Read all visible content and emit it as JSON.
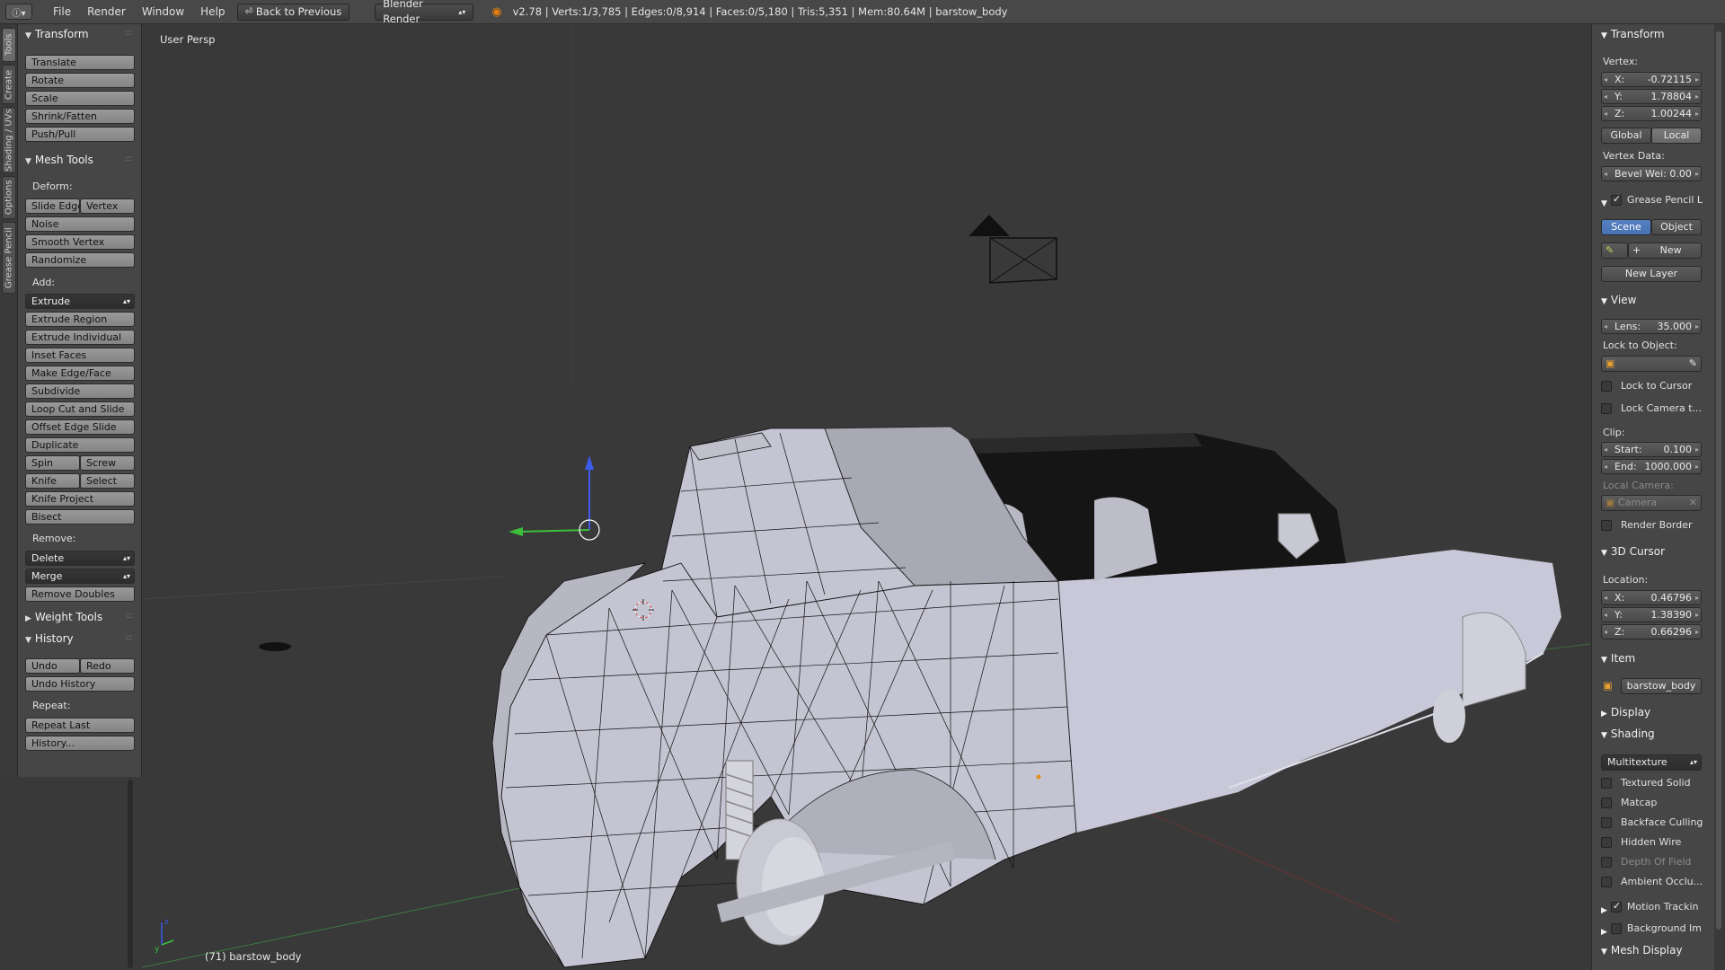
{
  "topbar": {
    "menus": [
      "File",
      "Render",
      "Window",
      "Help"
    ],
    "back_button": "Back to Previous",
    "engine": "Blender Render",
    "stats": "v2.78 | Verts:1/3,785 | Edges:0/8,914 | Faces:0/5,180 | Tris:5,351 | Mem:80.64M | barstow_body"
  },
  "tool_tabs": [
    "Tools",
    "Create",
    "Shading / UVs",
    "Options",
    "Grease Pencil"
  ],
  "left": {
    "transform": {
      "title": "Transform",
      "buttons": [
        "Translate",
        "Rotate",
        "Scale",
        "Shrink/Fatten",
        "Push/Pull"
      ]
    },
    "mesh_tools": {
      "title": "Mesh Tools",
      "deform_label": "Deform:",
      "slide_edge": "Slide Edge",
      "vertex": "Vertex",
      "noise": "Noise",
      "smooth_vertex": "Smooth Vertex",
      "randomize": "Randomize",
      "add_label": "Add:",
      "extrude": "Extrude",
      "extrude_region": "Extrude Region",
      "extrude_individual": "Extrude Individual",
      "inset_faces": "Inset Faces",
      "make_edge_face": "Make Edge/Face",
      "subdivide": "Subdivide",
      "loop_cut": "Loop Cut and Slide",
      "offset_edge": "Offset Edge Slide",
      "duplicate": "Duplicate",
      "spin": "Spin",
      "screw": "Screw",
      "knife": "Knife",
      "select": "Select",
      "knife_project": "Knife Project",
      "bisect": "Bisect",
      "remove_label": "Remove:",
      "delete": "Delete",
      "merge": "Merge",
      "remove_doubles": "Remove Doubles"
    },
    "weight_tools": {
      "title": "Weight Tools"
    },
    "history": {
      "title": "History",
      "undo": "Undo",
      "redo": "Redo",
      "undo_history": "Undo History",
      "repeat_label": "Repeat:",
      "repeat_last": "Repeat Last",
      "history_btn": "History..."
    }
  },
  "viewport": {
    "view_name": "User Persp",
    "object_label": "(71) barstow_body"
  },
  "right": {
    "transform": {
      "title": "Transform",
      "vertex_label": "Vertex:",
      "x_key": "X:",
      "x": "-0.72115",
      "y_key": "Y:",
      "y": "1.78804",
      "z_key": "Z:",
      "z": "1.00244",
      "global": "Global",
      "local": "Local",
      "vertex_data_label": "Vertex Data:",
      "bevel": "Bevel Wei: 0.00"
    },
    "grease": {
      "title": "Grease Pencil L",
      "scene": "Scene",
      "object": "Object",
      "new": "New",
      "new_layer": "New Layer"
    },
    "view": {
      "title": "View",
      "lens": "Lens:",
      "lens_val": "35.000",
      "lock_obj": "Lock to Object:",
      "lock_cursor": "Lock to Cursor",
      "lock_camera": "Lock Camera t...",
      "clip": "Clip:",
      "start": "Start:",
      "start_val": "0.100",
      "end": "End:",
      "end_val": "1000.000",
      "local_camera": "Local Camera:",
      "camera": "Camera",
      "render_border": "Render Border"
    },
    "cursor": {
      "title": "3D Cursor",
      "location": "Location:",
      "x_key": "X:",
      "x": "0.46796",
      "y_key": "Y:",
      "y": "1.38390",
      "z_key": "Z:",
      "z": "0.66296"
    },
    "item": {
      "title": "Item",
      "name": "barstow_body"
    },
    "display": {
      "title": "Display"
    },
    "shading": {
      "title": "Shading",
      "mode": "Multitexture",
      "textured_solid": "Textured Solid",
      "matcap": "Matcap",
      "backface": "Backface Culling",
      "hidden_wire": "Hidden Wire",
      "dof": "Depth Of Field",
      "ao": "Ambient Occlu..."
    },
    "motion": {
      "title": "Motion Trackin"
    },
    "background": {
      "title": "Background Im"
    },
    "mesh_display": {
      "title": "Mesh Display"
    }
  }
}
